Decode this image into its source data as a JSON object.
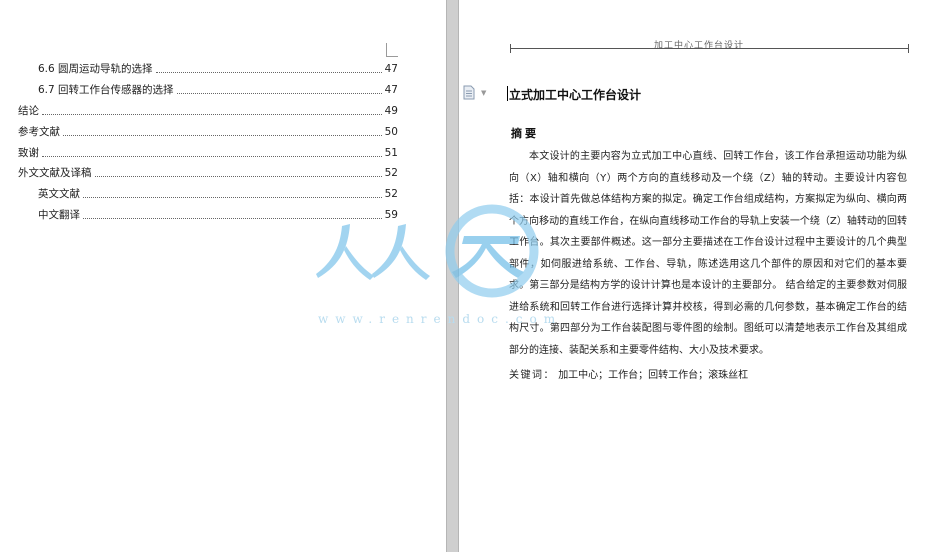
{
  "toc": {
    "entries": [
      {
        "title": "6.6  圆周运动导轨的选择",
        "page": "47",
        "level": 2
      },
      {
        "title": "6.7  回转工作台传感器的选择",
        "page": "47",
        "level": 2
      },
      {
        "title": "结论",
        "page": "49",
        "level": 1
      },
      {
        "title": "参考文献",
        "page": "50",
        "level": 1
      },
      {
        "title": "致谢",
        "page": "51",
        "level": 1
      },
      {
        "title": "外文文献及译稿",
        "page": "52",
        "level": 1
      },
      {
        "title": "英文文献",
        "page": "52",
        "level": 2
      },
      {
        "title": "中文翻译",
        "page": "59",
        "level": 2
      }
    ]
  },
  "right_page": {
    "header": "加工中心工作台设计",
    "title": "立式加工中心工作台设计",
    "abstract_heading": "摘要",
    "abstract_body": "本文设计的主要内容为立式加工中心直线、回转工作台，该工作台承担运动功能为纵向（X）轴和横向（Y）两个方向的直线移动及一个绕（Z）轴的转动。主要设计内容包括：本设计首先做总体结构方案的拟定。确定工作台组成结构，方案拟定为纵向、横向两个方向移动的直线工作台，在纵向直线移动工作台的导轨上安装一个绕（Z）轴转动的回转工作台。其次主要部件概述。这一部分主要描述在工作台设计过程中主要设计的几个典型部件，如伺服进给系统、工作台、导轨，陈述选用这几个部件的原因和对它们的基本要求。第三部分是结构方学的设计计算也是本设计的主要部分。 结合给定的主要参数对伺服进给系统和回转工作台进行选择计算并校核，得到必需的几何参数，基本确定工作台的结构尺寸。第四部分为工作台装配图与零件图的绘制。图纸可以清楚地表示工作台及其组成部分的连接、装配关系和主要零件结构、大小及技术要求。",
    "keywords_label": "关键词：",
    "keywords": "加工中心；工作台；回转工作台；滚珠丝杠"
  },
  "watermark": {
    "text": "人人文库",
    "url": "www.renrendoc.com"
  },
  "colors": {
    "watermark_blue": "#5fb4e4",
    "gutter": "#cfcfcf"
  }
}
